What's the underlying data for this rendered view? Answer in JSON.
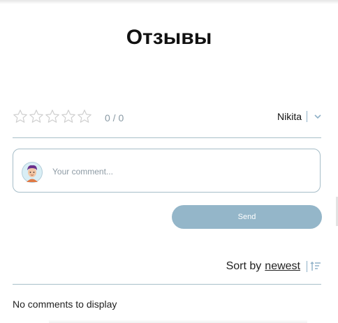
{
  "reviews": {
    "title": "Отзывы",
    "rating": {
      "stars_total": 5,
      "stars_filled": 0,
      "count_text": "0 / 0"
    },
    "user": {
      "name": "Nikita"
    },
    "comment": {
      "placeholder": "Your comment...",
      "value": ""
    },
    "send_label": "Send",
    "sort": {
      "prefix": "Sort by",
      "option": "newest"
    },
    "empty_text": "No comments to display"
  },
  "colors": {
    "accent": "#94b6c9",
    "divider": "#a8bfc9",
    "muted_text": "#8a9aa5",
    "star_outline": "#cfcfcf"
  },
  "icons": {
    "star": "star-outline-icon",
    "user_dropdown": "chevron-down-icon",
    "avatar": "avatar-icon",
    "sort": "sort-icon"
  }
}
